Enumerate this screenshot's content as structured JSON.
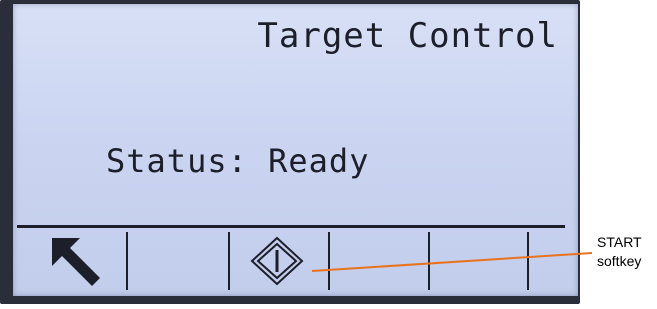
{
  "display": {
    "title": "Target Control",
    "status_text": "Status: Ready"
  },
  "softkeys": [
    {
      "icon": "home-arrow-icon"
    },
    {
      "icon": ""
    },
    {
      "icon": "start-diamond-icon"
    },
    {
      "icon": ""
    },
    {
      "icon": ""
    },
    {
      "icon": ""
    }
  ],
  "callout": {
    "line1": "START",
    "line2": "softkey",
    "color": "#e8731f"
  },
  "colors": {
    "lcd_background": "#cbd5f1",
    "lcd_text": "#1c1f2a",
    "bezel": "#2a2d3a"
  }
}
